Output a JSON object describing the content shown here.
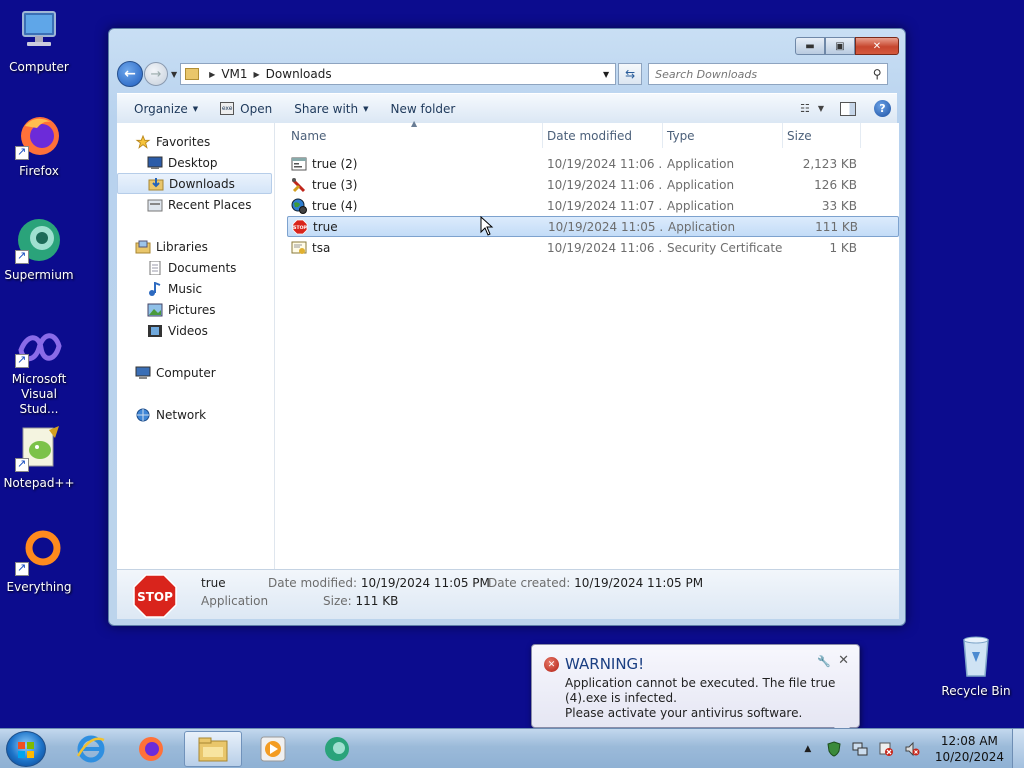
{
  "desktop": {
    "icons": [
      {
        "label": "Computer",
        "icon": "computer-icon"
      },
      {
        "label": "Firefox",
        "icon": "firefox-icon"
      },
      {
        "label": "Supermium",
        "icon": "supermium-icon"
      },
      {
        "label": "Microsoft Visual Stud...",
        "icon": "visual-studio-icon"
      },
      {
        "label": "Notepad++",
        "icon": "notepadpp-icon"
      },
      {
        "label": "Everything",
        "icon": "everything-icon"
      },
      {
        "label": "Recycle Bin",
        "icon": "recycle-bin-icon"
      }
    ]
  },
  "explorer": {
    "breadcrumb": [
      "VM1",
      "Downloads"
    ],
    "search_placeholder": "Search Downloads",
    "toolbar": {
      "organize": "Organize",
      "open": "Open",
      "share_with": "Share with",
      "new_folder": "New folder"
    },
    "nav": {
      "favorites": "Favorites",
      "desktop": "Desktop",
      "downloads": "Downloads",
      "recent_places": "Recent Places",
      "libraries": "Libraries",
      "documents": "Documents",
      "music": "Music",
      "pictures": "Pictures",
      "videos": "Videos",
      "computer": "Computer",
      "network": "Network"
    },
    "columns": {
      "name": "Name",
      "date_modified": "Date modified",
      "type": "Type",
      "size": "Size"
    },
    "files": [
      {
        "name": "true (2)",
        "date": "10/19/2024 11:06 ...",
        "type": "Application",
        "size": "2,123 KB",
        "icon": "app-window-icon"
      },
      {
        "name": "true (3)",
        "date": "10/19/2024 11:06 ...",
        "type": "Application",
        "size": "126 KB",
        "icon": "tools-icon"
      },
      {
        "name": "true (4)",
        "date": "10/19/2024 11:07 ...",
        "type": "Application",
        "size": "33 KB",
        "icon": "globe-gear-icon"
      },
      {
        "name": "true",
        "date": "10/19/2024 11:05 ...",
        "type": "Application",
        "size": "111 KB",
        "icon": "stop-sign-icon"
      },
      {
        "name": "tsa",
        "date": "10/19/2024 11:06 ...",
        "type": "Security Certificate",
        "size": "1 KB",
        "icon": "certificate-icon"
      }
    ],
    "details": {
      "name": "true",
      "type": "Application",
      "date_modified_label": "Date modified:",
      "date_modified": "10/19/2024 11:05 PM",
      "date_created_label": "Date created:",
      "date_created": "10/19/2024 11:05 PM",
      "size_label": "Size:",
      "size": "111 KB",
      "stop_text": "STOP"
    }
  },
  "notification": {
    "title": "WARNING!",
    "line1": "Application cannot be executed. The file true (4).exe is infected.",
    "line2": "Please activate your antivirus software."
  },
  "taskbar": {
    "time": "12:08 AM",
    "date": "10/20/2024"
  }
}
